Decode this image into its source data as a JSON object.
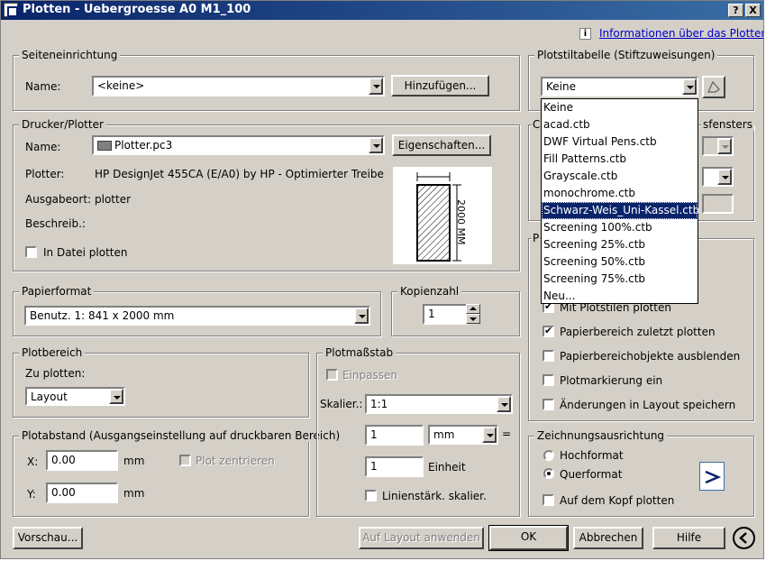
{
  "window": {
    "title": "Plotten - Uebergroesse A0 M1_100",
    "help_btn": "?",
    "close_btn": "X"
  },
  "info_link": "Informationen über das Plotten",
  "seiten": {
    "legend": "Seiteneinrichtung",
    "name_label": "Name:",
    "name_value": "<keine>",
    "add_button": "Hinzufügen..."
  },
  "drucker": {
    "legend": "Drucker/Plotter",
    "name_label": "Name:",
    "name_value": "Plotter.pc3",
    "props_button": "Eigenschaften...",
    "plotter_label": "Plotter:",
    "plotter_value": "HP DesignJet 455CA (E/A0) by HP - Optimierter Treiberr...",
    "ausgabe_label": "Ausgabeort:",
    "ausgabe_value": "plotter",
    "beschreib_label": "Beschreib.:",
    "to_file_label": "In Datei plotten",
    "preview_dim": "2000 MM"
  },
  "papier": {
    "legend": "Papierformat",
    "value": "Benutz. 1: 841 x 2000 mm"
  },
  "kopien": {
    "legend": "Kopienzahl",
    "value": "1"
  },
  "plotbereich": {
    "legend": "Plotbereich",
    "label": "Zu plotten:",
    "value": "Layout"
  },
  "plotabstand": {
    "legend": "Plotabstand (Ausgangseinstellung auf druckbaren Bereich)",
    "x_label": "X:",
    "x_value": "0.00",
    "y_label": "Y:",
    "y_value": "0.00",
    "unit": "mm",
    "center_label": "Plot zentrieren"
  },
  "massstab": {
    "legend": "Plotmaßstab",
    "fit_label": "Einpassen",
    "scale_label": "Skalier.:",
    "scale_value": "1:1",
    "val1": "1",
    "unit_value": "mm",
    "equals": "=",
    "val2": "1",
    "einheit": "Einheit",
    "lineweight_label": "Linienstärk. skalier."
  },
  "stiltabelle": {
    "legend": "Plotstiltabelle (Stiftzuweisungen)",
    "value": "Keine",
    "options": [
      "Keine",
      "acad.ctb",
      "DWF Virtual Pens.ctb",
      "Fill Patterns.ctb",
      "Grayscale.ctb",
      "monochrome.ctb",
      "Schwarz-Weis_Uni-Kassel.ctb",
      "Screening 100%.ctb",
      "Screening 25%.ctb",
      "Screening 50%.ctb",
      "Screening 75%.ctb",
      "Neu..."
    ],
    "selected_index": 6
  },
  "behind": {
    "ca_fragment": "Ca",
    "fenster_fragment": "sfensters",
    "p_fragment": "P"
  },
  "optionen": {
    "mit_plotstilen": "Mit Plotstilen plotten",
    "papier_zuletzt": "Papierbereich zuletzt plotten",
    "papier_ausblenden": "Papierbereichobjekte ausblenden",
    "plotmarkierung": "Plotmarkierung ein",
    "aenderungen": "Änderungen in Layout speichern"
  },
  "ausrichtung": {
    "legend": "Zeichnungsausrichtung",
    "hoch": "Hochformat",
    "quer": "Querformat",
    "kopf": "Auf dem Kopf plotten"
  },
  "footer": {
    "preview": "Vorschau...",
    "apply": "Auf Layout anwenden",
    "ok": "OK",
    "cancel": "Abbrechen",
    "help": "Hilfe"
  },
  "colors": {
    "dialog_bg": "#d4d0c8",
    "title_start": "#0a246a",
    "title_end": "#3a6ea5",
    "selection": "#0a246a",
    "link": "#0000cc"
  }
}
